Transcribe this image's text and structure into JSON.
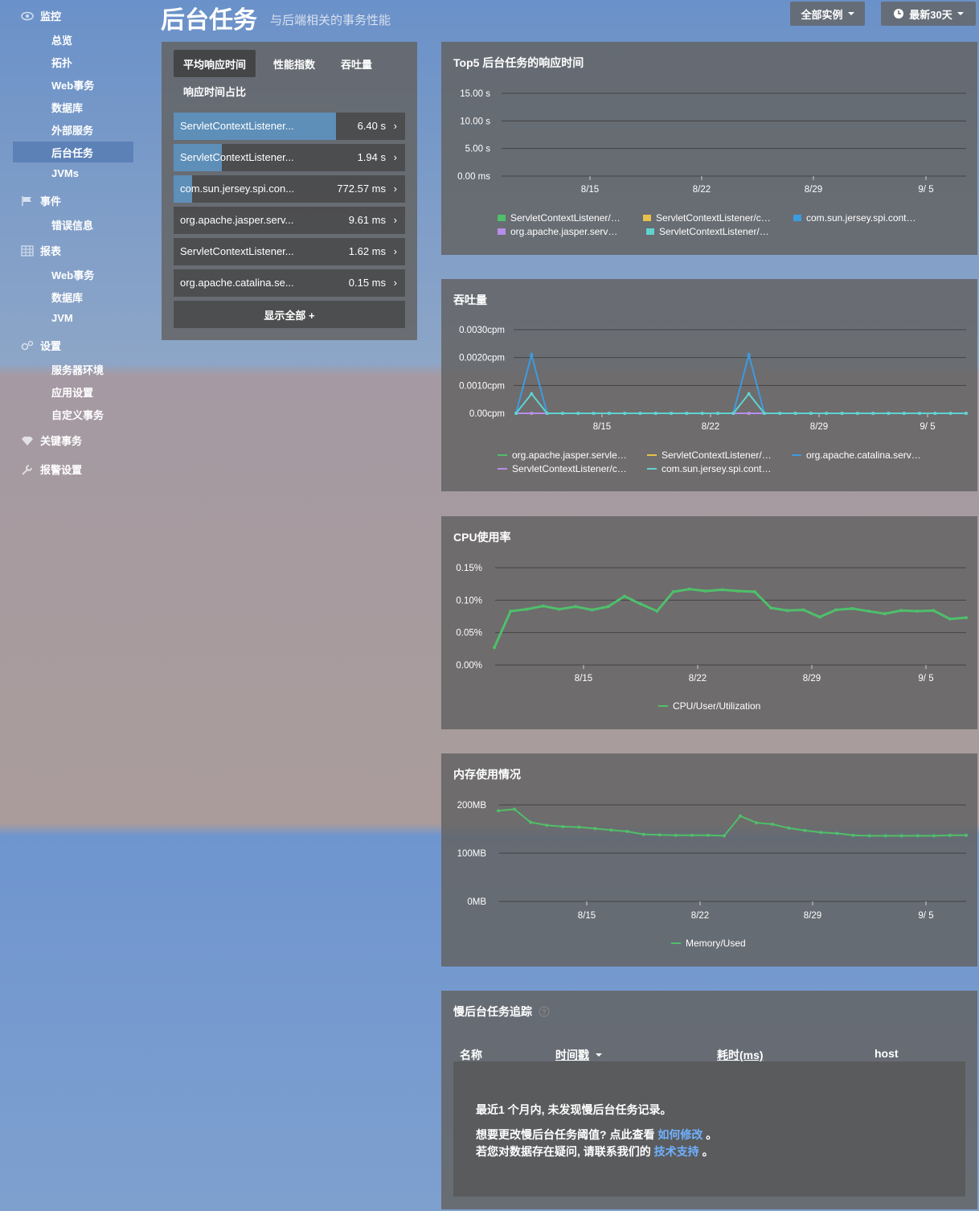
{
  "sidebar": {
    "groups": [
      {
        "label": "监控",
        "icon": "eye-icon",
        "items": [
          "总览",
          "拓扑",
          "Web事务",
          "数据库",
          "外部服务",
          "后台任务",
          "JVMs"
        ]
      },
      {
        "label": "事件",
        "icon": "flag-icon",
        "items": [
          "错误信息"
        ]
      },
      {
        "label": "报表",
        "icon": "table-icon",
        "items": [
          "Web事务",
          "数据库",
          "JVM"
        ]
      },
      {
        "label": "设置",
        "icon": "gears-icon",
        "items": [
          "服务器环境",
          "应用设置",
          "自定义事务"
        ]
      },
      {
        "label": "关键事务",
        "icon": "diamond-icon",
        "items": []
      },
      {
        "label": "报警设置",
        "icon": "wrench-icon",
        "items": []
      }
    ],
    "active_item": "后台任务"
  },
  "header": {
    "title": "后台任务",
    "subtitle": "与后端相关的事务性能",
    "instances_button": "全部实例",
    "time_button": "最新30天"
  },
  "left_panel": {
    "tabs": [
      "平均响应时间",
      "性能指数",
      "吞吐量",
      "响应时间占比"
    ],
    "active_tab": "平均响应时间",
    "rows": [
      {
        "name": "ServletContextListener...",
        "value": "6.40 s",
        "fill": 0.7
      },
      {
        "name": "ServletContextListener...",
        "value": "1.94 s",
        "fill": 0.21
      },
      {
        "name": "com.sun.jersey.spi.con...",
        "value": "772.57 ms",
        "fill": 0.08
      },
      {
        "name": "org.apache.jasper.serv...",
        "value": "9.61 ms",
        "fill": 0
      },
      {
        "name": "ServletContextListener...",
        "value": "1.62 ms",
        "fill": 0
      },
      {
        "name": "org.apache.catalina.se...",
        "value": "0.15 ms",
        "fill": 0
      }
    ],
    "show_all": "显示全部 +"
  },
  "charts": {
    "top5": {
      "title": "Top5 后台任务的响应时间",
      "chart_data": {
        "type": "bar",
        "y_ticks": [
          "15.00 s",
          "10.00 s",
          "5.00 s",
          "0.00 ms"
        ],
        "x_ticks": [
          "8/15",
          "8/22",
          "8/29",
          "9/ 5"
        ],
        "series": [
          {
            "name": "ServletContextListener/…",
            "color": "#4fbf6a",
            "values": []
          },
          {
            "name": "ServletContextListener/c…",
            "color": "#e8c14d",
            "values": []
          },
          {
            "name": "com.sun.jersey.spi.cont…",
            "color": "#3d9be0",
            "values": []
          },
          {
            "name": "org.apache.jasper.serv…",
            "color": "#b68ee8",
            "values": []
          },
          {
            "name": "ServletContextListener/…",
            "color": "#5fd3cf",
            "values": []
          }
        ]
      }
    },
    "throughput": {
      "title": "吞吐量",
      "chart_data": {
        "type": "line",
        "y_ticks": [
          "0.0030cpm",
          "0.0020cpm",
          "0.0010cpm",
          "0.00cpm"
        ],
        "ylim": [
          0,
          0.003
        ],
        "x_ticks": [
          "8/15",
          "8/22",
          "8/29",
          "9/ 5"
        ],
        "series": [
          {
            "name": "org.apache.jasper.servle…",
            "color": "#4fbf6a",
            "values": [
              0,
              0,
              0,
              0,
              0,
              0,
              0,
              0,
              0,
              0,
              0,
              0,
              0,
              0,
              0,
              0,
              0,
              0,
              0,
              0,
              0,
              0,
              0,
              0,
              0,
              0,
              0,
              0,
              0,
              0
            ]
          },
          {
            "name": "ServletContextListener/…",
            "color": "#e8c14d",
            "values": [
              0,
              0,
              0,
              0,
              0,
              0,
              0,
              0,
              0,
              0,
              0,
              0,
              0,
              0,
              0,
              0,
              0,
              0,
              0,
              0,
              0,
              0,
              0,
              0,
              0,
              0,
              0,
              0,
              0,
              0
            ]
          },
          {
            "name": "org.apache.catalina.serv…",
            "color": "#3d9be0",
            "values": [
              0,
              0.0021,
              0,
              0,
              0,
              0,
              0,
              0,
              0,
              0,
              0,
              0,
              0,
              0,
              0,
              0.0021,
              0,
              0,
              0,
              0,
              0,
              0,
              0,
              0,
              0,
              0,
              0,
              0,
              0,
              0
            ]
          },
          {
            "name": "ServletContextListener/c…",
            "color": "#b68ee8",
            "values": [
              0,
              0,
              0,
              0,
              0,
              0,
              0,
              0,
              0,
              0,
              0,
              0,
              0,
              0,
              0,
              0,
              0,
              0,
              0,
              0,
              0,
              0,
              0,
              0,
              0,
              0,
              0,
              0,
              0,
              0
            ]
          },
          {
            "name": "com.sun.jersey.spi.cont…",
            "color": "#5fd3cf",
            "values": [
              0,
              0.0007,
              0,
              0,
              0,
              0,
              0,
              0,
              0,
              0,
              0,
              0,
              0,
              0,
              0,
              0.0007,
              0,
              0,
              0,
              0,
              0,
              0,
              0,
              0,
              0,
              0,
              0,
              0,
              0,
              0
            ]
          }
        ]
      }
    },
    "cpu": {
      "title": "CPU使用率",
      "chart_data": {
        "type": "line",
        "y_ticks": [
          "0.15%",
          "0.10%",
          "0.05%",
          "0.00%"
        ],
        "ylim": [
          0,
          0.15
        ],
        "x_ticks": [
          "8/15",
          "8/22",
          "8/29",
          "9/ 5"
        ],
        "series": [
          {
            "name": "CPU/User/Utilization",
            "color": "#4fbf6a",
            "values": [
              0.027,
              0.083,
              0.086,
              0.091,
              0.086,
              0.09,
              0.085,
              0.09,
              0.106,
              0.094,
              0.083,
              0.113,
              0.117,
              0.114,
              0.116,
              0.114,
              0.113,
              0.088,
              0.084,
              0.085,
              0.074,
              0.085,
              0.087,
              0.083,
              0.079,
              0.084,
              0.083,
              0.084,
              0.071,
              0.073
            ]
          }
        ]
      }
    },
    "memory": {
      "title": "内存使用情况",
      "chart_data": {
        "type": "line",
        "y_ticks": [
          "200MB",
          "100MB",
          "0MB"
        ],
        "ylim": [
          0,
          200
        ],
        "x_ticks": [
          "8/15",
          "8/22",
          "8/29",
          "9/ 5"
        ],
        "series": [
          {
            "name": "Memory/Used",
            "color": "#4fbf6a",
            "values": [
              188,
              191,
              164,
              158,
              155,
              154,
              151,
              148,
              145,
              139,
              138,
              137,
              137,
              137,
              136,
              177,
              163,
              160,
              152,
              147,
              143,
              141,
              137,
              136,
              136,
              136,
              136,
              136,
              137,
              137
            ]
          }
        ]
      }
    }
  },
  "slow_table": {
    "title": "慢后台任务追踪",
    "help_icon": "question-circle-icon",
    "columns": [
      "名称",
      "时间戳",
      "耗时(ms)",
      "host"
    ],
    "empty_line1": "最近1 个月内, 未发现慢后台任务记录。",
    "empty_line2_prefix": "想要更改慢后台任务阈值? 点此查看",
    "empty_line2_link": "如何修改",
    "empty_line2_suffix": "。",
    "empty_line3_prefix": "若您对数据存在疑问, 请联系我们的",
    "empty_line3_link": "技术支持",
    "empty_line3_suffix": "。"
  }
}
